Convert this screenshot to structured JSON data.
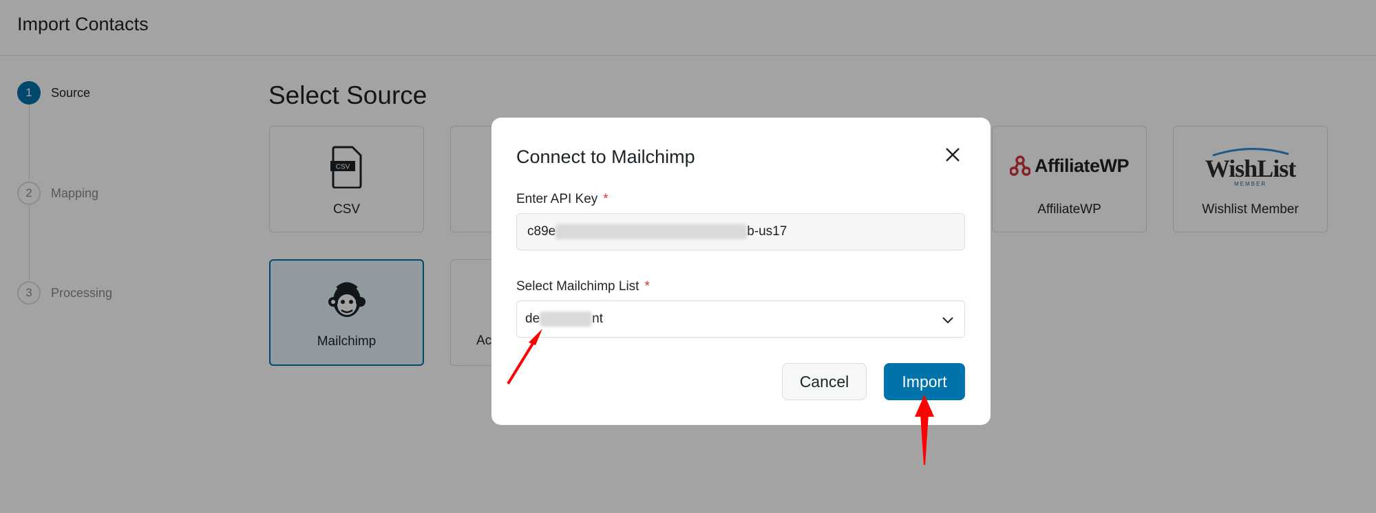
{
  "header": {
    "title": "Import Contacts"
  },
  "stepper": {
    "steps": [
      {
        "num": "1",
        "label": "Source",
        "active": true
      },
      {
        "num": "2",
        "label": "Mapping",
        "active": false
      },
      {
        "num": "3",
        "label": "Processing",
        "active": false
      }
    ]
  },
  "main": {
    "title": "Select Source",
    "sources": [
      {
        "label": "CSV",
        "icon": "csv-file-icon"
      },
      {
        "label": "AffiliateWP",
        "icon": "affiliatewp-logo",
        "logo_text": "AffiliateWP"
      },
      {
        "label": "Wishlist Member",
        "icon": "wishlist-logo",
        "logo_text": "WishList",
        "logo_subtext": "MEMBER"
      },
      {
        "label": "Mailchimp",
        "icon": "mailchimp-logo",
        "selected": true
      },
      {
        "label": "Ac",
        "icon": "partial-card"
      }
    ]
  },
  "modal": {
    "title": "Connect to Mailchimp",
    "api_key": {
      "label": "Enter API Key",
      "required_marker": "*",
      "value_prefix": "c89e",
      "value_suffix": "b-us17"
    },
    "list": {
      "label": "Select Mailchimp List",
      "required_marker": "*",
      "value_prefix": "de",
      "value_suffix": "nt"
    },
    "cancel_label": "Cancel",
    "import_label": "Import"
  },
  "colors": {
    "accent": "#0073aa",
    "required": "#d63638",
    "annotation_arrow": "#ff0000",
    "affiliatewp_red": "#d0363c",
    "wishlist_dark": "#2d2d2d"
  }
}
